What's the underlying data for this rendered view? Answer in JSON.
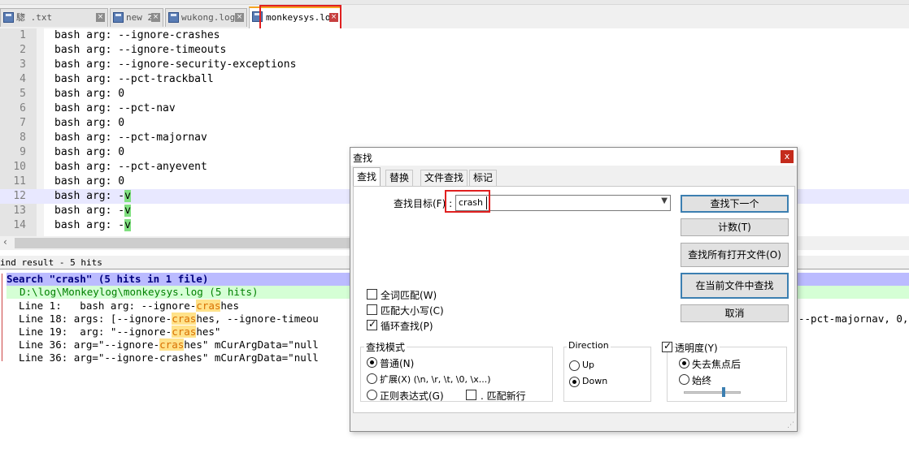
{
  "tabs": [
    {
      "label": "騘              .txt",
      "active": false
    },
    {
      "label": "new 2",
      "active": false
    },
    {
      "label": "wukong.log",
      "active": false
    },
    {
      "label": "monkeysys.log",
      "active": true
    }
  ],
  "editor": {
    "lines": [
      {
        "n": "1",
        "text": "bash arg: --ignore-crashes"
      },
      {
        "n": "2",
        "text": "bash arg: --ignore-timeouts"
      },
      {
        "n": "3",
        "text": "bash arg: --ignore-security-exceptions"
      },
      {
        "n": "4",
        "text": "bash arg: --pct-trackball"
      },
      {
        "n": "5",
        "text": "bash arg: 0"
      },
      {
        "n": "6",
        "text": "bash arg: --pct-nav"
      },
      {
        "n": "7",
        "text": "bash arg: 0"
      },
      {
        "n": "8",
        "text": "bash arg: --pct-majornav"
      },
      {
        "n": "9",
        "text": "bash arg: 0"
      },
      {
        "n": "10",
        "text": "bash arg: --pct-anyevent"
      },
      {
        "n": "11",
        "text": "bash arg: 0"
      },
      {
        "n": "12",
        "text": "bash arg: -",
        "sel": "v"
      },
      {
        "n": "13",
        "text": "bash arg: -",
        "sel": "v"
      },
      {
        "n": "14",
        "text": "bash arg: -",
        "sel": "v"
      }
    ]
  },
  "find_result": {
    "title": "ind result - 5 hits",
    "search_line": "Search \"crash\" (5 hits in 1 file)",
    "file_line": "D:\\log\\Monkeylog\\monkeysys.log (5 hits)",
    "hits": [
      {
        "pre": "  Line 1:   bash arg: --ignore-",
        "hit": "cras",
        "post": "hes"
      },
      {
        "pre": "  Line 18: args: [--ignore-",
        "hit": "cras",
        "post": "hes, --ignore-timeou"
      },
      {
        "pre": "  Line 19:  arg: \"--ignore-",
        "hit": "cras",
        "post": "hes\""
      },
      {
        "pre": "  Line 36: arg=\"--ignore-",
        "hit": "cras",
        "post": "hes\" mCurArgData=\"null"
      },
      {
        "pre": "  Line 36: arg=\"--ignore-crashes\" mCurArgData=\"null",
        "hit": "",
        "post": ""
      }
    ],
    "right_fragment": "--pct-majornav, 0,"
  },
  "dialog": {
    "title": "查找",
    "close": "x",
    "tabs": [
      "查找",
      "替换",
      "文件查找",
      "标记"
    ],
    "target_label": "查找目标(F) :",
    "target_value": "crash",
    "buttons": {
      "find_next": "查找下一个",
      "count": "计数(T)",
      "find_all_open": "查找所有打开文件(O)",
      "find_in_current": "在当前文件中查找",
      "cancel": "取消"
    },
    "options": {
      "whole_word": "全词匹配(W)",
      "match_case": "匹配大小写(C)",
      "wrap_around": "循环查找(P)"
    },
    "search_mode": {
      "label": "查找模式",
      "normal": "普通(N)",
      "extended": "扩展(X) (\\n, \\r, \\t, \\0, \\x...)",
      "regex": "正则表达式(G)",
      "dot_newline": ". 匹配新行"
    },
    "direction": {
      "label": "Direction",
      "up": "Up",
      "down": "Down"
    },
    "transparency": {
      "label": "透明度(Y)",
      "on_lose_focus": "失去焦点后",
      "always": "始终",
      "level": 0.7
    }
  }
}
